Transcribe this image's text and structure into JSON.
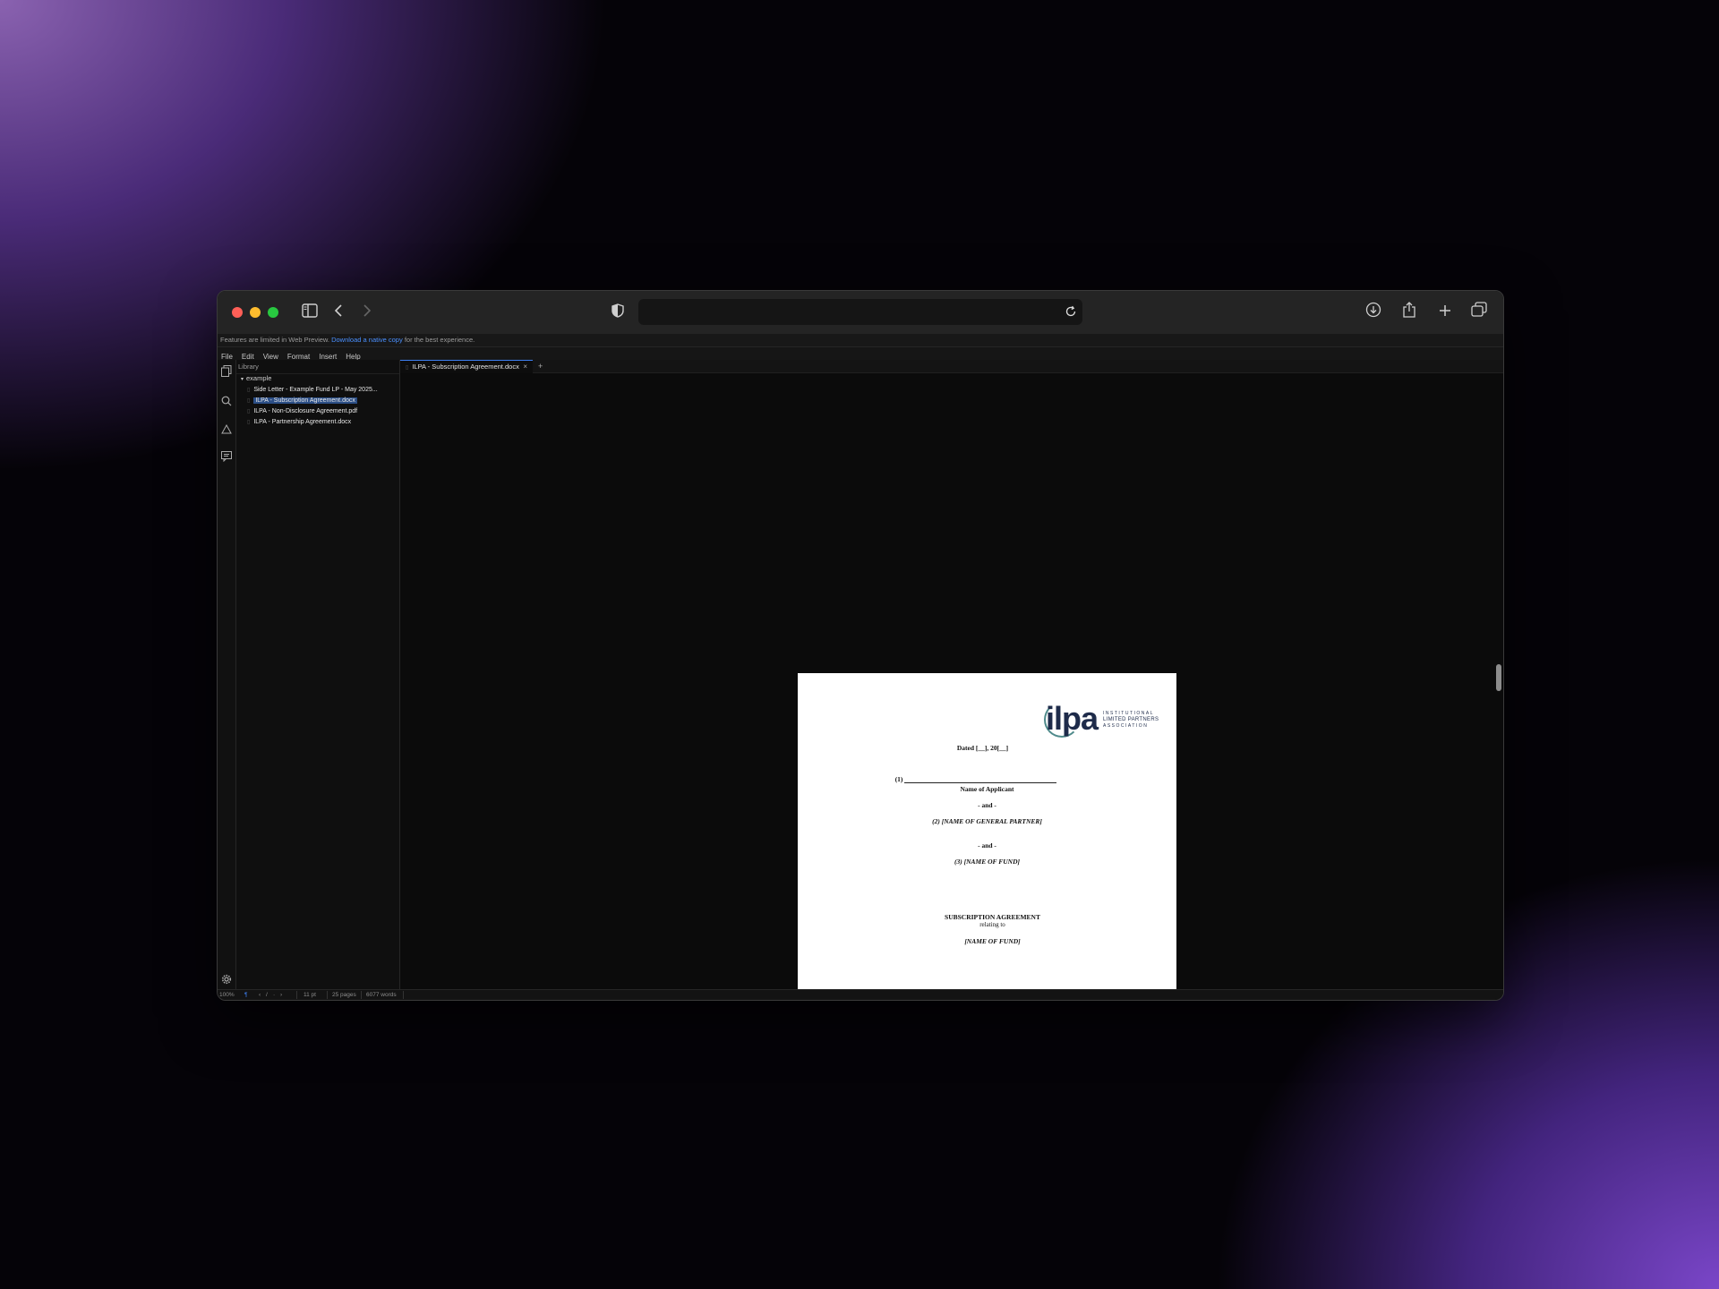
{
  "banner": {
    "prefix": "Features are limited in Web Preview.",
    "link": "Download a native copy",
    "suffix": "for the best experience."
  },
  "menu": [
    "File",
    "Edit",
    "View",
    "Format",
    "Insert",
    "Help"
  ],
  "sidebar": {
    "title": "Library",
    "folder": "example",
    "files": [
      "Side Letter - Example Fund LP - May 2025...",
      "ILPA - Subscription Agreement.docx",
      "ILPA - Non-Disclosure Agreement.pdf",
      "ILPA - Partnership Agreement.docx"
    ],
    "selected_index": 1
  },
  "tab": {
    "label": "ILPA - Subscription Agreement.docx",
    "close": "×",
    "add": "+"
  },
  "document": {
    "logo_word": "ilpa",
    "logo_lines": [
      "INSTITUTIONAL",
      "LIMITED PARTNERS",
      "ASSOCIATION"
    ],
    "dated": "Dated [__], 20[__]",
    "party1_num": "(1)",
    "party1_label": "Name of Applicant",
    "and1": "- and -",
    "party2": "(2) [NAME OF GENERAL PARTNER]",
    "and2": "- and -",
    "party3": "(3) [NAME OF FUND]",
    "title": "SUBSCRIPTION AGREEMENT",
    "relating": "relating to",
    "fund": "[NAME OF FUND]"
  },
  "status": {
    "zoom": "100%",
    "font_size": "11 pt",
    "pages": "25 pages",
    "words": "6077 words"
  },
  "icons": {
    "sidebar_toggle": "sidebar-icon",
    "back": "chevron-left-icon",
    "forward": "chevron-right-icon",
    "shield": "shield-icon",
    "reload": "reload-icon",
    "download": "download-icon",
    "share": "share-icon",
    "new_tab": "plus-icon",
    "tabs_overview": "tabs-icon"
  }
}
